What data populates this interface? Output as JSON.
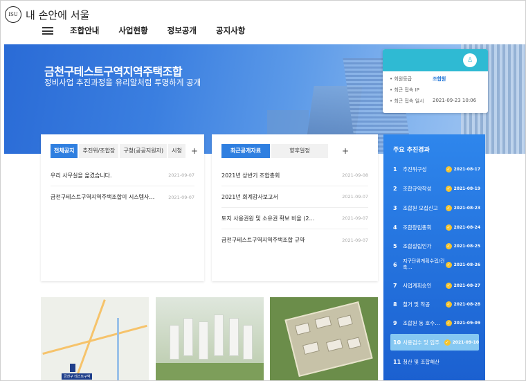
{
  "header": {
    "logo_symbol": "I·SEOUL·U",
    "logo_text": "내 손안에 서울",
    "nav": [
      "조합안내",
      "사업현황",
      "정보공개",
      "공지사항"
    ]
  },
  "hero": {
    "title": "금천구테스트구역지역주택조합",
    "subtitle": "정비사업 추진과정을 유리알처럼 투명하게 공개"
  },
  "member": {
    "rows": [
      {
        "label": "회원등급",
        "value": "조합원"
      },
      {
        "label": "최근 접속 IP",
        "value": ""
      },
      {
        "label": "최근 접속 일시",
        "value": "2021-09-23 10:06"
      }
    ]
  },
  "notice_panel": {
    "tabs": [
      "전체공지",
      "추진위/조합장",
      "구청(공공지원자)",
      "시청"
    ],
    "plus": "+",
    "items": [
      {
        "title": "우리 사무실을 옮겼습니다.",
        "date": "2021-09-07"
      },
      {
        "title": "금천구테스트구역지역주택조합이 시스템사…",
        "date": "2021-09-07"
      }
    ]
  },
  "data_panel": {
    "tabs": [
      "최근공개자료",
      "향후일정"
    ],
    "plus": "+",
    "items": [
      {
        "title": "2021년 상반기 조합총회",
        "date": "2021-09-08"
      },
      {
        "title": "2021년 회계감사보고서",
        "date": "2021-09-07"
      },
      {
        "title": "토지 사용권원 및 소유권 확보 비율 (2…",
        "date": "2021-09-07"
      },
      {
        "title": "금천구테스트구역지역주택조합 규약",
        "date": "2021-09-07"
      }
    ]
  },
  "progress": {
    "title": "주요 추진경과",
    "steps": [
      {
        "num": "1",
        "label": "추진위구성",
        "date": "2021-08-17",
        "done": true
      },
      {
        "num": "2",
        "label": "조합규약작성",
        "date": "2021-08-19",
        "done": true
      },
      {
        "num": "3",
        "label": "조합원 모집신고",
        "date": "2021-08-23",
        "done": true
      },
      {
        "num": "4",
        "label": "조합창립총회",
        "date": "2021-08-24",
        "done": true
      },
      {
        "num": "5",
        "label": "조합설립인가",
        "date": "2021-08-25",
        "done": true
      },
      {
        "num": "6",
        "label": "지구단위계획수립/건축…",
        "date": "2021-08-26",
        "done": true
      },
      {
        "num": "7",
        "label": "사업계획승인",
        "date": "2021-08-27",
        "done": true
      },
      {
        "num": "8",
        "label": "철거 및 착공",
        "date": "2021-08-28",
        "done": true
      },
      {
        "num": "9",
        "label": "조합원 동 호수…",
        "date": "2021-09-09",
        "done": true
      },
      {
        "num": "10",
        "label": "사용검수 및 입주",
        "date": "2021-09-10",
        "done": true
      },
      {
        "num": "11",
        "label": "청산 및 조합해산",
        "date": "",
        "done": false
      }
    ],
    "active_index": 9
  },
  "thumbnails": {
    "map_label": "금천구 테스트구역"
  }
}
